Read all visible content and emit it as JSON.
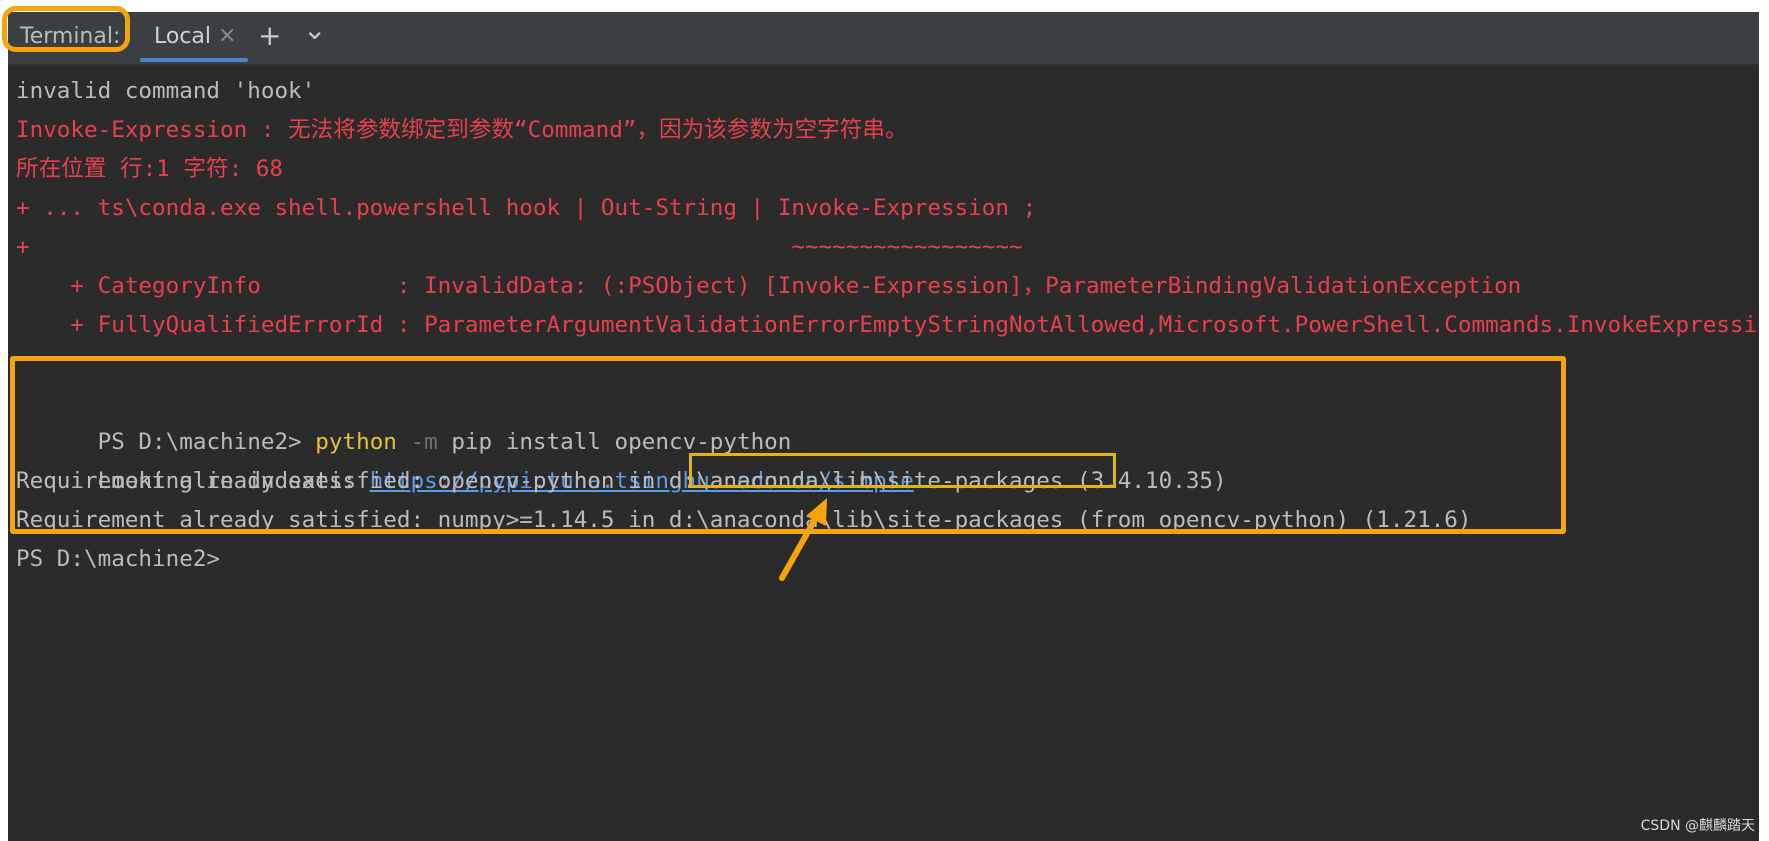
{
  "tabbar": {
    "title": "Terminal:",
    "tab_label": "Local",
    "close_glyph": "×",
    "add_glyph": "+",
    "menu_glyph": "⌄"
  },
  "terminal": {
    "l1": "invalid command 'hook'",
    "l2": "Invoke-Expression : 无法将参数绑定到参数“Command”，因为该参数为空字符串。",
    "l3": "所在位置 行:1 字符: 68",
    "l4": "+ ... ts\\conda.exe shell.powershell hook | Out-String | Invoke-Expression ;",
    "l5": "+                                                        ~~~~~~~~~~~~~~~~~",
    "l6": "    + CategoryInfo          : InvalidData: (:PSObject) [Invoke-Expression]，ParameterBindingValidationException",
    "l7": "    + FullyQualifiedErrorId : ParameterArgumentValidationErrorEmptyStringNotAllowed,Microsoft.PowerShell.Commands.InvokeExpressionCommand",
    "prompt1": "PS D:\\machine2> ",
    "cmd_python": "python",
    "cmd_flag": " -m",
    "cmd_rest": " pip install opencv-python",
    "l9_prefix": "Looking in indexes: ",
    "l9_url": "https://pypi.tuna.tsinghua.edu.cn/simple",
    "l10": "Requirement already satisfied: opencv-python in d:\\anaconda\\lib\\site-packages (3.4.10.35)",
    "l11": "Requirement already satisfied: numpy>=1.14.5 in d:\\anaconda\\lib\\site-packages (from opencv-python) (1.21.6)",
    "prompt2": "PS D:\\machine2>"
  },
  "watermark": "CSDN @麒麟踏天",
  "colors": {
    "accent": "#f5a50a",
    "error": "#e8404a",
    "link": "#5c9bea"
  }
}
